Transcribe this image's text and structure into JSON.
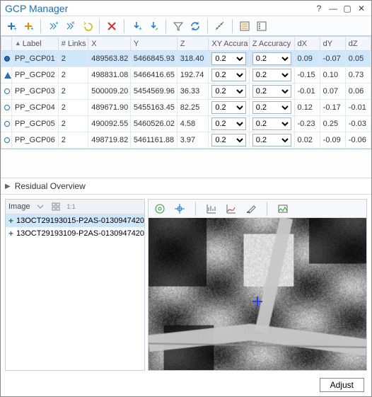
{
  "window": {
    "title": "GCP Manager"
  },
  "toolbar_icons": {
    "add1": "add-gcp",
    "add2": "add-tie",
    "tool3": "sparkle-plus",
    "tool4": "sparkle-x",
    "undo": "undo",
    "delete": "delete",
    "down_add": "arrow-down-plus",
    "down_arrow": "arrow-down",
    "filter": "filter",
    "refresh": "refresh",
    "measure": "measure",
    "list": "list",
    "options": "options"
  },
  "table": {
    "headers": {
      "label": "Label",
      "links": "# Links",
      "x": "X",
      "y": "Y",
      "z": "Z",
      "xya": "XY Accura",
      "za": "Z Accuracy",
      "dx": "dX",
      "dy": "dY",
      "dz": "dZ"
    },
    "rows": [
      {
        "shape": "sel",
        "label": "PP_GCP01",
        "links": "2",
        "x": "489563.82",
        "y": "5466845.93",
        "z": "318.40",
        "xya": "0.2",
        "za": "0.2",
        "dx": "0.09",
        "dy": "-0.07",
        "dz": "0.05",
        "selected": true
      },
      {
        "shape": "tri",
        "label": "PP_GCP02",
        "links": "2",
        "x": "498831.08",
        "y": "5466416.65",
        "z": "192.74",
        "xya": "0.2",
        "za": "0.2",
        "dx": "-0.15",
        "dy": "0.10",
        "dz": "0.73"
      },
      {
        "shape": "circ",
        "label": "PP_GCP03",
        "links": "2",
        "x": "500009.20",
        "y": "5454569.96",
        "z": "36.33",
        "xya": "0.2",
        "za": "0.2",
        "dx": "-0.01",
        "dy": "0.07",
        "dz": "0.06"
      },
      {
        "shape": "circ",
        "label": "PP_GCP04",
        "links": "2",
        "x": "489671.90",
        "y": "5455163.45",
        "z": "82.25",
        "xya": "0.2",
        "za": "0.2",
        "dx": "0.12",
        "dy": "-0.17",
        "dz": "-0.01"
      },
      {
        "shape": "circ",
        "label": "PP_GCP05",
        "links": "2",
        "x": "490092.55",
        "y": "5460526.02",
        "z": "4.58",
        "xya": "0.2",
        "za": "0.2",
        "dx": "-0.23",
        "dy": "0.25",
        "dz": "-0.03"
      },
      {
        "shape": "circ",
        "label": "PP_GCP06",
        "links": "2",
        "x": "498719.82",
        "y": "5461161.88",
        "z": "3.97",
        "xya": "0.2",
        "za": "0.2",
        "dx": "0.02",
        "dy": "-0.09",
        "dz": "-0.06"
      }
    ]
  },
  "residual": {
    "title": "Residual Overview"
  },
  "image_panel": {
    "title": "Image",
    "items": [
      {
        "color": "g",
        "name": "13OCT29193015-P2AS-0130947420",
        "selected": true
      },
      {
        "color": "b",
        "name": "13OCT29193109-P2AS-0130947420"
      }
    ]
  },
  "footer": {
    "adjust": "Adjust"
  }
}
